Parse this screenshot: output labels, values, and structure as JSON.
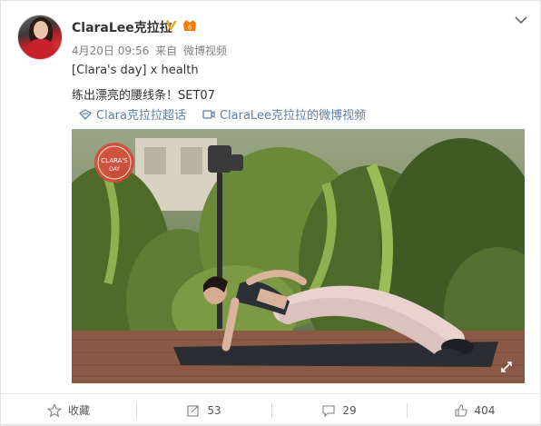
{
  "post": {
    "author": "ClaraLee克拉拉",
    "time": "4月20日 09:56",
    "source_prefix": "来自",
    "source": "微博视频",
    "line1": "[Clara's day] x health",
    "line2": "练出漂亮的腰线条！SET07",
    "topics": [
      {
        "label": "Clara克拉拉超话",
        "icon": "supertopic-icon"
      },
      {
        "label": "ClaraLee克拉拉的微博视频",
        "icon": "video-icon"
      }
    ],
    "video_badge": {
      "line1": "CLARA'S",
      "line2": "DAY"
    }
  },
  "actions": {
    "favorite": "收藏",
    "repost": "53",
    "comment": "29",
    "like": "404"
  },
  "colors": {
    "link": "#5d7fa8",
    "verified": "#f5a623",
    "vip": "#ff7a00"
  }
}
